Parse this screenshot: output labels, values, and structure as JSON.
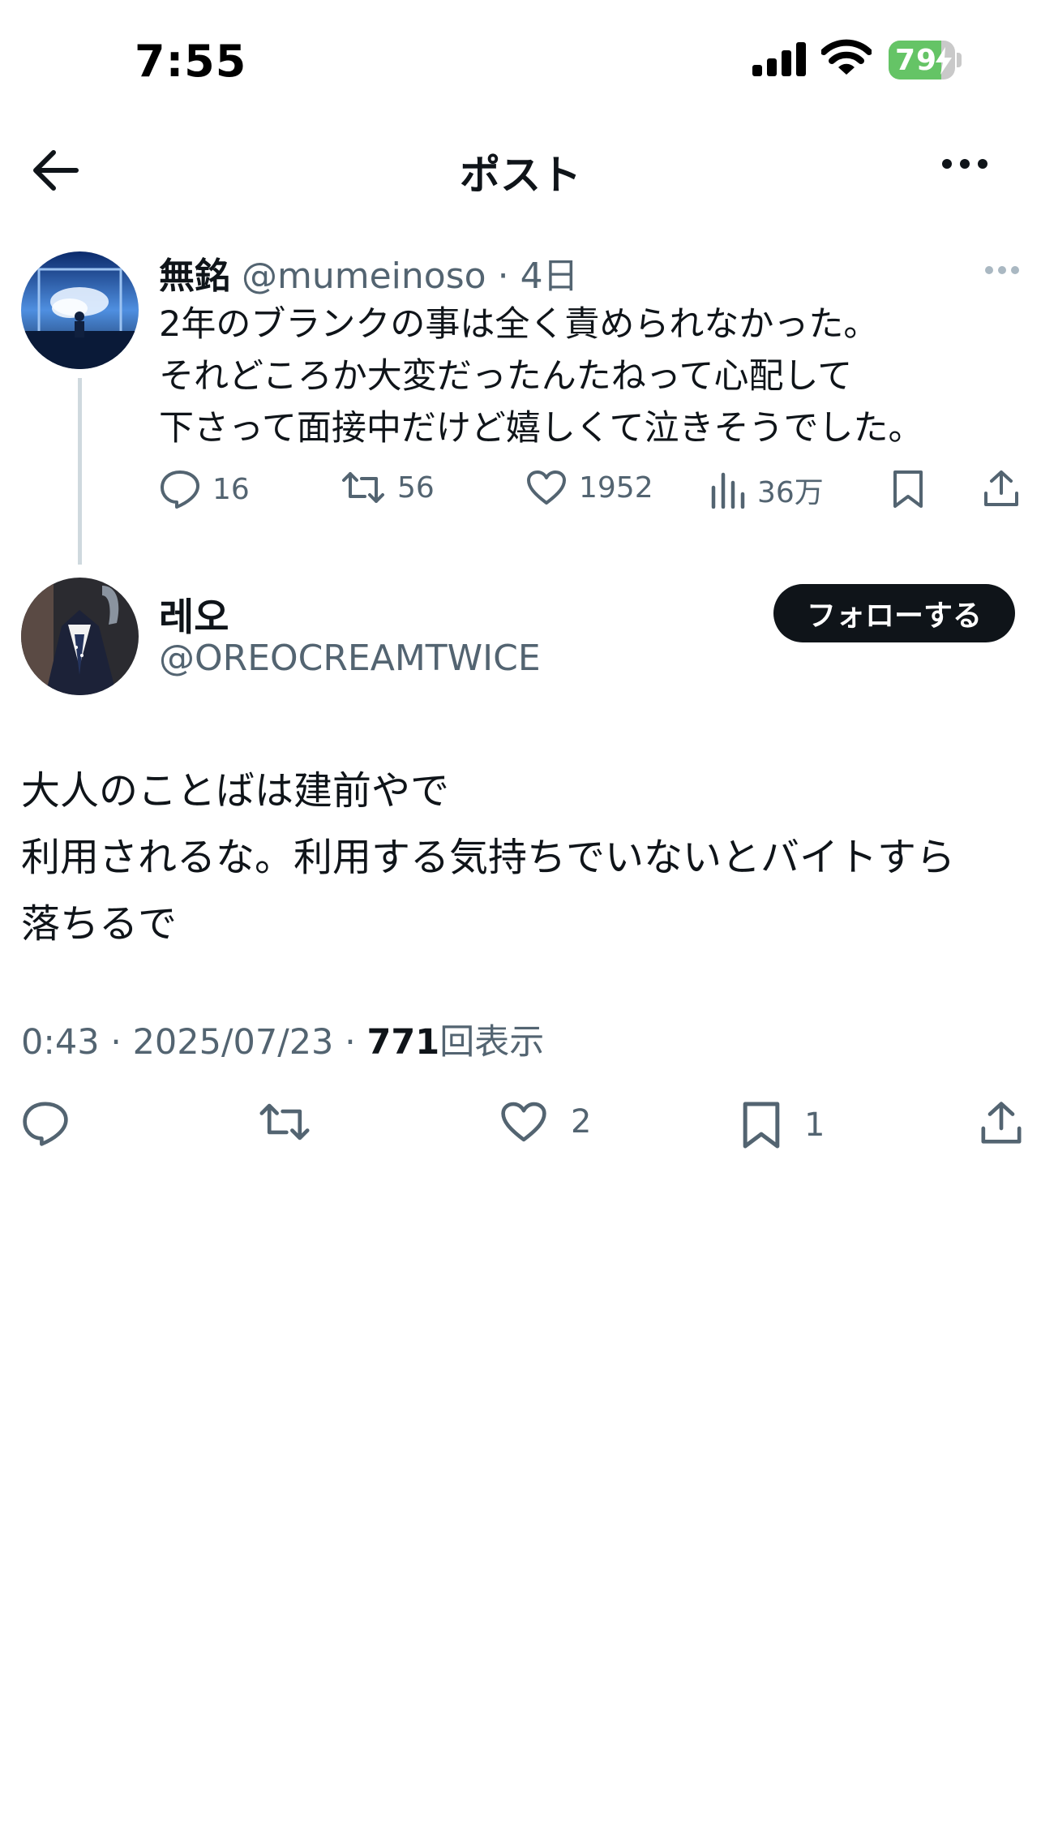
{
  "status_bar": {
    "time": "7:55",
    "battery": "79",
    "battery_level": 0.79
  },
  "header": {
    "title": "ポスト"
  },
  "quoted_tweet": {
    "name": "無銘",
    "handle": "@mumeinoso",
    "separator": "·",
    "age": "4日",
    "text": "2年のブランクの事は全く責められなかった。\nそれどころか大変だったんたねって心配して\n下さって面接中だけど嬉しくて泣きそうでした。",
    "replies": "16",
    "retweets": "56",
    "likes": "1952",
    "views": "36万"
  },
  "tweet": {
    "author_name": "레오",
    "author_handle": "@OREOCREAMTWICE",
    "follow_label": "フォローする",
    "text": "大人のことばは建前やで\n利用されるな。利用する気持ちでいないとバイトすら\n落ちるで",
    "time": "0:43",
    "date": "2025/07/23",
    "separator": "·",
    "views_count": "771",
    "views_label": "回表示",
    "likes": "2",
    "bookmarks": "1"
  },
  "colors": {
    "text": "#0f1419",
    "secondary": "#536471",
    "thread_line": "#cfd9de",
    "battery_green": "#65c466"
  }
}
